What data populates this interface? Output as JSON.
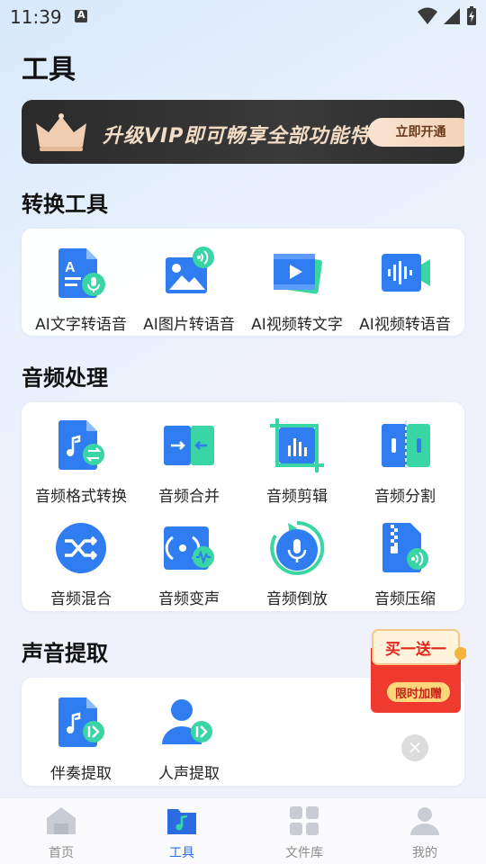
{
  "status_bar": {
    "time": "11:39"
  },
  "page": {
    "title": "工具"
  },
  "vip_banner": {
    "text": "升级VIP即可畅享全部功能特权",
    "button": "立即开通"
  },
  "sections": [
    {
      "title": "转换工具",
      "tools": [
        {
          "label": "AI文字转语音",
          "icon": "text-to-speech-icon"
        },
        {
          "label": "AI图片转语音",
          "icon": "image-to-speech-icon"
        },
        {
          "label": "AI视频转文字",
          "icon": "video-to-text-icon"
        },
        {
          "label": "AI视频转语音",
          "icon": "video-to-speech-icon"
        }
      ]
    },
    {
      "title": "音频处理",
      "tools": [
        {
          "label": "音频格式转换",
          "icon": "audio-format-convert-icon"
        },
        {
          "label": "音频合并",
          "icon": "audio-merge-icon"
        },
        {
          "label": "音频剪辑",
          "icon": "audio-clip-icon"
        },
        {
          "label": "音频分割",
          "icon": "audio-split-icon"
        },
        {
          "label": "音频混合",
          "icon": "audio-mix-icon"
        },
        {
          "label": "音频变声",
          "icon": "voice-change-icon"
        },
        {
          "label": "音频倒放",
          "icon": "audio-reverse-icon"
        },
        {
          "label": "音频压缩",
          "icon": "audio-compress-icon"
        }
      ]
    },
    {
      "title": "声音提取",
      "tools": [
        {
          "label": "伴奏提取",
          "icon": "accompaniment-extract-icon"
        },
        {
          "label": "人声提取",
          "icon": "vocal-extract-icon"
        }
      ]
    }
  ],
  "promo": {
    "top_text": "买一送一",
    "bottom_text": "限时加赠"
  },
  "tab_bar": {
    "active": "工具",
    "tabs": [
      {
        "label": "首页",
        "icon": "home-icon"
      },
      {
        "label": "工具",
        "icon": "tools-icon"
      },
      {
        "label": "文件库",
        "icon": "file-library-icon"
      },
      {
        "label": "我的",
        "icon": "profile-icon"
      }
    ]
  },
  "colors": {
    "accent": "#2b6de0",
    "icon_blue": "#2f7df0",
    "icon_green": "#39d5a4",
    "promo_red": "#ef3b2f"
  }
}
